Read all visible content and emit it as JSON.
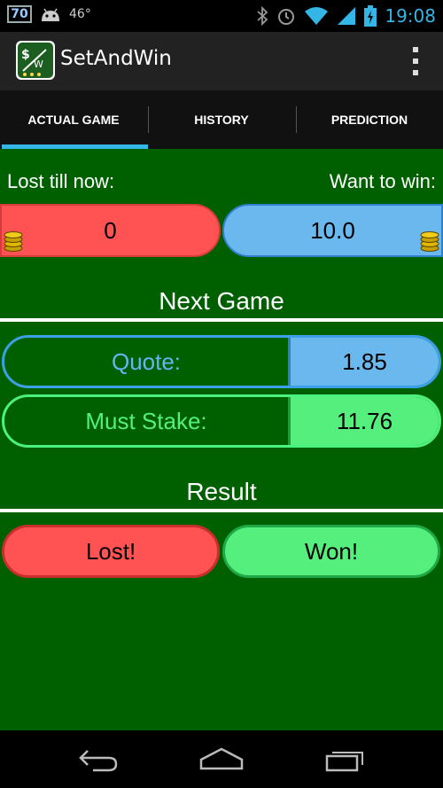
{
  "status_bar": {
    "notification_badge": "70",
    "temperature": "46°",
    "time": "19:08",
    "icons": [
      "android-icon",
      "bluetooth-icon",
      "alarm-icon",
      "wifi-icon",
      "signal-icon",
      "battery-charging-icon"
    ]
  },
  "action_bar": {
    "title": "SetAndWin",
    "icon": "app-logo-icon",
    "menu_icon": "overflow-menu-icon"
  },
  "tabs": [
    {
      "label": "ACTUAL GAME",
      "selected": true
    },
    {
      "label": "HISTORY",
      "selected": false
    },
    {
      "label": "PREDICTION",
      "selected": false
    }
  ],
  "game": {
    "lost_label": "Lost till now:",
    "want_label": "Want to win:",
    "lost_value": "0",
    "want_value": "10.0",
    "next_game_title": "Next Game",
    "quote_label": "Quote:",
    "quote_value": "1.85",
    "stake_label": "Must Stake:",
    "stake_value": "11.76",
    "result_title": "Result",
    "lost_button": "Lost!",
    "won_button": "Won!"
  },
  "colors": {
    "background": "#006000",
    "red": "#ff5252",
    "blue": "#6ab8ee",
    "green": "#55ef7d",
    "accent": "#33b5e5"
  },
  "nav_bar": {
    "icons": [
      "back-icon",
      "home-icon",
      "recents-icon"
    ]
  }
}
